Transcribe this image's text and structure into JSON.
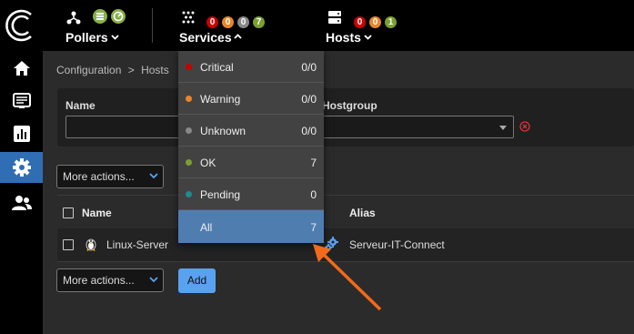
{
  "topbar": {
    "pollers": {
      "label": "Pollers"
    },
    "services": {
      "label": "Services",
      "counts": [
        {
          "value": "0",
          "color": "#cc0000"
        },
        {
          "value": "0",
          "color": "#e8862b"
        },
        {
          "value": "0",
          "color": "#888888"
        },
        {
          "value": "7",
          "color": "#7aa033"
        }
      ]
    },
    "hosts": {
      "label": "Hosts",
      "counts": [
        {
          "value": "0",
          "color": "#cc0000"
        },
        {
          "value": "0",
          "color": "#e8862b"
        },
        {
          "value": "1",
          "color": "#7aa033"
        }
      ]
    }
  },
  "sidebar": {
    "items": [
      {
        "icon": "home-icon"
      },
      {
        "icon": "monitoring-icon"
      },
      {
        "icon": "reporting-icon"
      },
      {
        "icon": "configuration-icon",
        "active": true
      },
      {
        "icon": "administration-icon"
      }
    ]
  },
  "breadcrumb": {
    "parts": [
      "Configuration",
      ">",
      "Hosts"
    ]
  },
  "filters": {
    "name_label": "Name",
    "name_value": "",
    "hostgroup_label": "Hostgroup",
    "hostgroup_value": ""
  },
  "actions": {
    "more_actions_top": "More actions...",
    "more_actions_bottom": "More actions...",
    "add_label": "Add"
  },
  "table": {
    "columns": [
      "Name",
      "Alias"
    ],
    "rows": [
      {
        "name": "Linux-Server",
        "alias": "Serveur-IT-Connect",
        "os_icon": "linux-icon"
      }
    ]
  },
  "services_dropdown": {
    "items": [
      {
        "label": "Critical",
        "count": "0/0",
        "color": "#cc0000"
      },
      {
        "label": "Warning",
        "count": "0/0",
        "color": "#e8862b"
      },
      {
        "label": "Unknown",
        "count": "0/0",
        "color": "#888888"
      },
      {
        "label": "OK",
        "count": "7",
        "color": "#7aa033"
      },
      {
        "label": "Pending",
        "count": "0",
        "color": "#1f8c8c"
      },
      {
        "label": "All",
        "count": "7",
        "selected": true
      }
    ]
  },
  "annotation": {
    "arrow_color": "#f26a1b"
  }
}
